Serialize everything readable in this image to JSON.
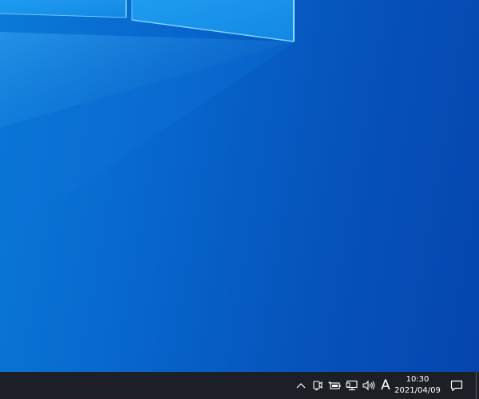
{
  "desktop": {
    "wallpaper": "windows-10-hero-light-panes",
    "colors": {
      "background_start": "#0a7ad8",
      "background_end": "#0546ae",
      "pane_fill": "#1a92e8",
      "pane_edge": "#7fd0ff"
    }
  },
  "taskbar": {
    "background": "#1c1f25",
    "tray": {
      "overflow_icon": "chevron-up-icon",
      "meet_icon": "meet-now-icon",
      "battery_icon": "battery-charging-icon",
      "network_icon": "ethernet-network-icon",
      "volume_icon": "speaker-volume-icon",
      "ime_indicator": "A",
      "clock": {
        "time": "10:30",
        "date": "2021/04/09"
      },
      "notifications_icon": "action-center-icon"
    }
  }
}
